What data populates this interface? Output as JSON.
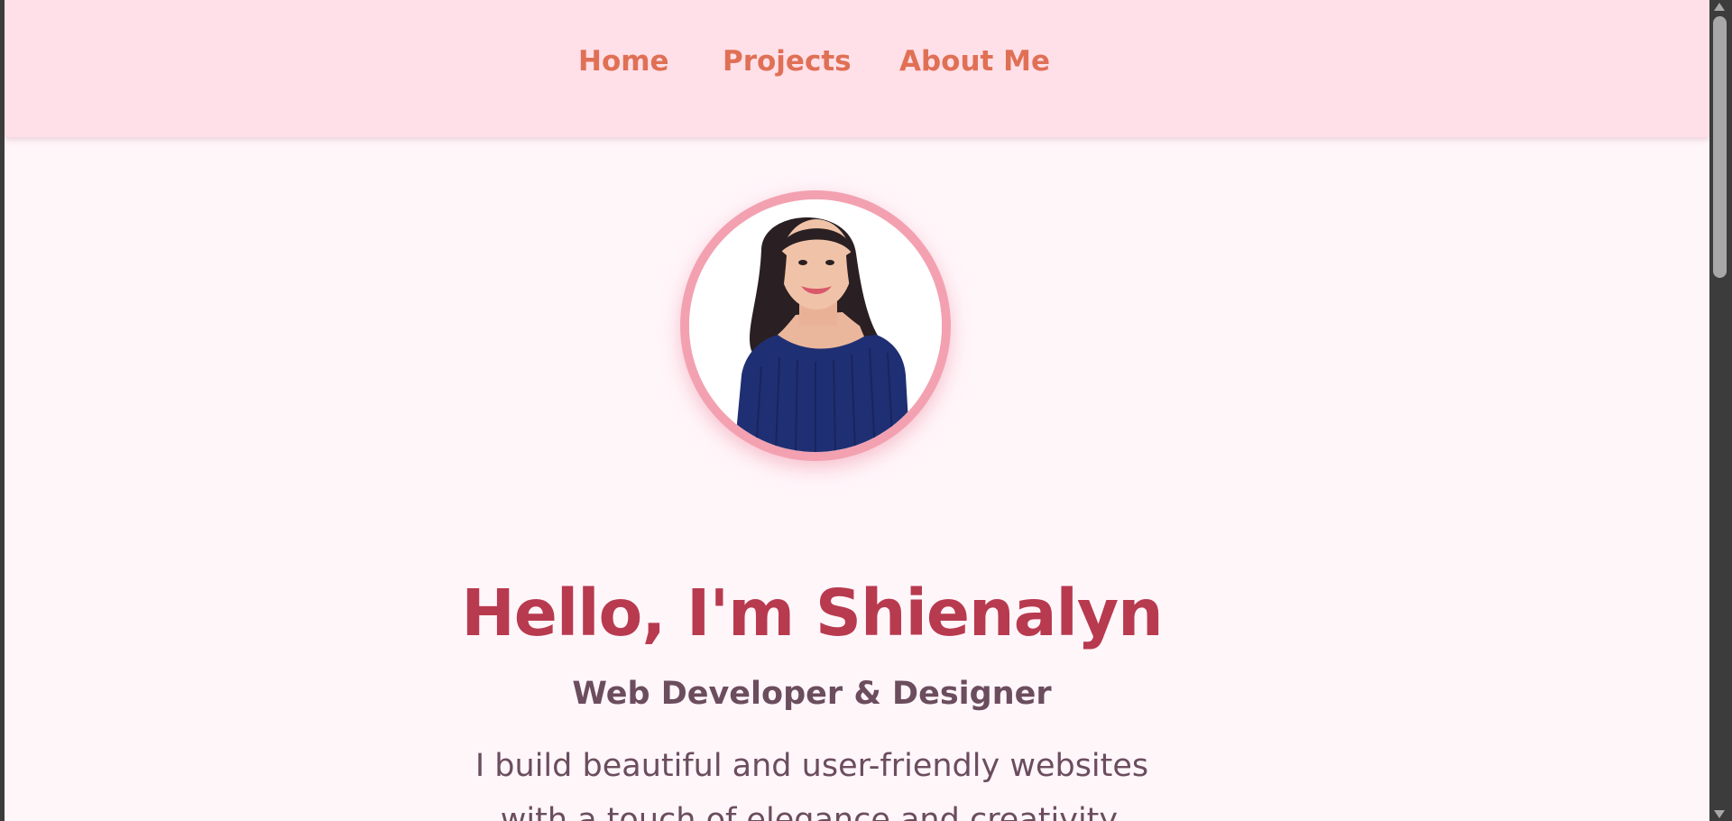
{
  "nav": {
    "items": [
      {
        "label": "Home"
      },
      {
        "label": "Projects"
      },
      {
        "label": "About Me"
      }
    ]
  },
  "hero": {
    "title": "Hello, I'm Shienalyn",
    "role": "Web Developer & Designer",
    "description_lines": [
      "I build beautiful and user-friendly websites",
      "with a touch of elegance and creativity."
    ]
  },
  "icons": {
    "profile_photo": "profile-photo",
    "scroll_up": "triangle-up-icon",
    "scroll_down": "triangle-down-icon"
  },
  "colors": {
    "navbar_bg": "#ffdfe8",
    "page_bg": "#fff6fa",
    "nav_link": "#e07055",
    "title": "#b83a4f",
    "body_text": "#6b4d5e",
    "avatar_ring": "#f3a1b1"
  }
}
